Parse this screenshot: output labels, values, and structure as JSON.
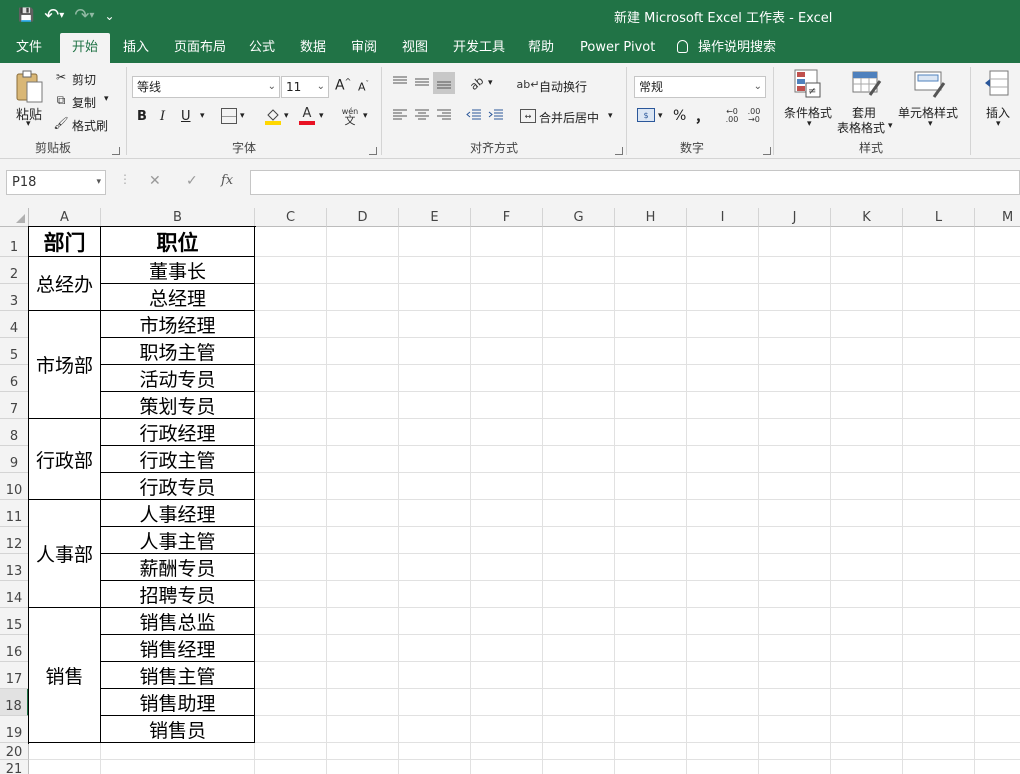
{
  "window": {
    "title": "新建 Microsoft Excel 工作表  -  Excel",
    "qat": {
      "save": "💾",
      "undo": "↶",
      "undo_caret": "▾",
      "redo": "↷",
      "redo_caret": "▾",
      "customize": "⌄"
    }
  },
  "tabs": [
    {
      "label": "文件"
    },
    {
      "label": "开始"
    },
    {
      "label": "插入"
    },
    {
      "label": "页面布局"
    },
    {
      "label": "公式"
    },
    {
      "label": "数据"
    },
    {
      "label": "审阅"
    },
    {
      "label": "视图"
    },
    {
      "label": "开发工具"
    },
    {
      "label": "帮助"
    },
    {
      "label": "Power Pivot"
    },
    {
      "label": "操作说明搜索"
    }
  ],
  "ribbon": {
    "clipboard": {
      "paste": "粘贴",
      "cut": "剪切",
      "copy": "复制",
      "format_painter": "格式刷",
      "label": "剪贴板"
    },
    "font": {
      "font_name": "等线",
      "font_size": "11",
      "bold": "B",
      "italic": "I",
      "underline": "U",
      "label": "字体",
      "wen": "wén",
      "wen_char": "文"
    },
    "alignment": {
      "wrap": "自动换行",
      "merge": "合并后居中",
      "label": "对齐方式"
    },
    "number": {
      "format": "常规",
      "percent": "%",
      "comma": "，",
      "label": "数字"
    },
    "styles": {
      "conditional": "条件格式",
      "table_fmt_1": "套用",
      "table_fmt_2": "表格格式",
      "cell_styles": "单元格样式",
      "label": "样式"
    },
    "cells": {
      "insert": "插入"
    }
  },
  "formula_bar": {
    "name_box": "P18",
    "cancel": "✕",
    "enter": "✓",
    "fx": "fx",
    "value": ""
  },
  "columns": [
    "A",
    "B",
    "C",
    "D",
    "E",
    "F",
    "G",
    "H",
    "I",
    "J",
    "K",
    "L",
    "M"
  ],
  "rows": [
    "1",
    "2",
    "3",
    "4",
    "5",
    "6",
    "7",
    "8",
    "9",
    "10",
    "11",
    "12",
    "13",
    "14",
    "15",
    "16",
    "17",
    "18",
    "19",
    "20",
    "21"
  ],
  "sheet": {
    "header": {
      "dept": "部门",
      "position": "职位"
    },
    "departments": [
      "总经办",
      "市场部",
      "行政部",
      "人事部",
      "销售"
    ],
    "positions": [
      "董事长",
      "总经理",
      "市场经理",
      "职场主管",
      "活动专员",
      "策划专员",
      "行政经理",
      "行政主管",
      "行政专员",
      "人事经理",
      "人事主管",
      "薪酬专员",
      "招聘专员",
      "销售总监",
      "销售经理",
      "销售主管",
      "销售助理",
      "销售员"
    ]
  }
}
